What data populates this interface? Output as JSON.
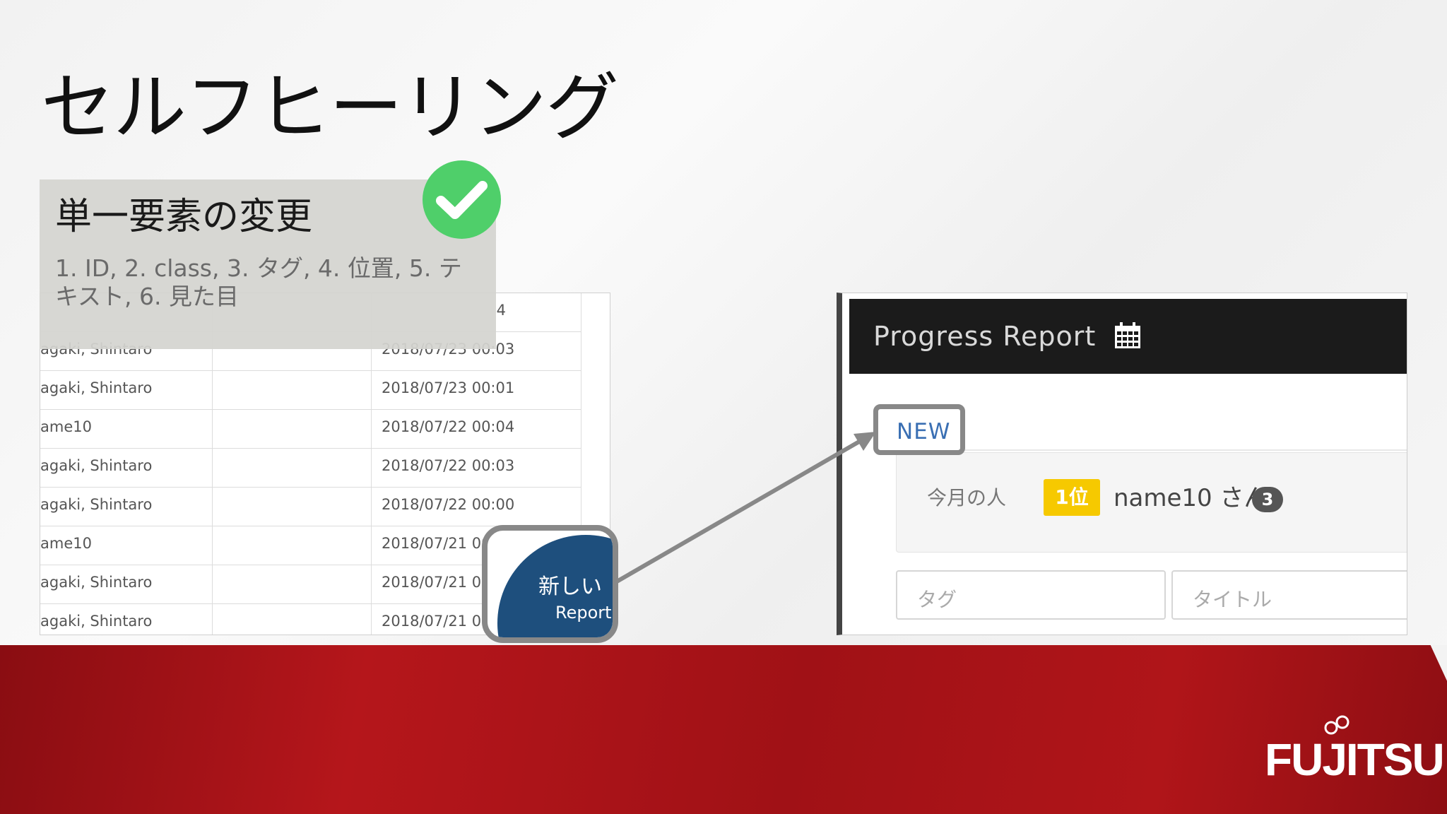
{
  "slide": {
    "title": "セルフヒーリング",
    "info_box": {
      "title": "単一要素の変更",
      "items": "1. ID, 2. class, 3. タグ, 4. 位置, 5. テキスト, 6. 見た目"
    }
  },
  "left_table": {
    "rows": [
      {
        "name": "",
        "date": "4"
      },
      {
        "name": "agaki, Shintaro",
        "date": "2018/07/23 00:03"
      },
      {
        "name": "agaki, Shintaro",
        "date": "2018/07/23 00:01"
      },
      {
        "name": "ame10",
        "date": "2018/07/22 00:04"
      },
      {
        "name": "agaki, Shintaro",
        "date": "2018/07/22 00:03"
      },
      {
        "name": "agaki, Shintaro",
        "date": "2018/07/22 00:00"
      },
      {
        "name": "ame10",
        "date": "2018/07/21 00:05"
      },
      {
        "name": "agaki, Shintaro",
        "date": "2018/07/21 00:0"
      },
      {
        "name": "agaki, Shintaro",
        "date": "2018/07/21 00:0"
      }
    ],
    "new_report_button": {
      "line1": "新しい",
      "line2": "Report"
    }
  },
  "progress_report": {
    "title": "Progress Report",
    "calendar_icon": "calendar-icon",
    "new_label": "NEW",
    "month_label": "今月の人",
    "rank_badge": "1位",
    "person": "name10 さん",
    "count": "3",
    "tag_placeholder": "タグ",
    "title_placeholder": "タイトル"
  },
  "footer": {
    "logo": "FUJITSU"
  },
  "colors": {
    "check_green": "#4fcf6a",
    "report_blue": "#1e4f7d",
    "header_dark": "#1b1b1b",
    "rank_yellow": "#f6c900",
    "footer_red": "#b5161b",
    "highlight_gray": "#888888"
  }
}
